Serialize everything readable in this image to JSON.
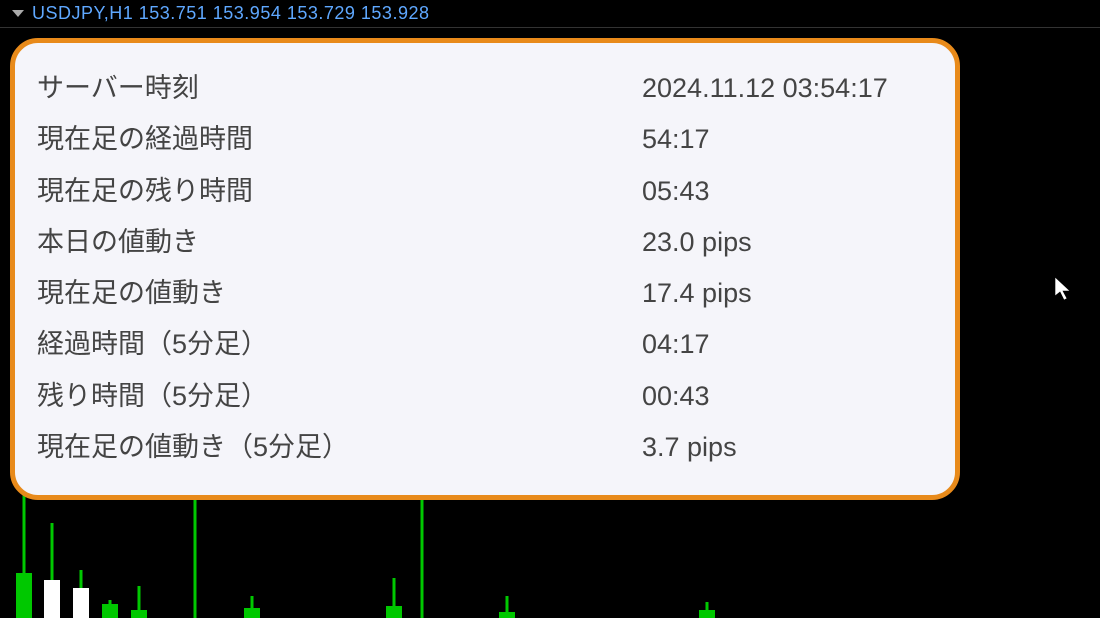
{
  "header": {
    "title": "USDJPY,H1  153.751 153.954 153.729 153.928"
  },
  "info": {
    "rows": [
      {
        "label": "サーバー時刻",
        "value": "2024.11.12 03:54:17"
      },
      {
        "label": "現在足の経過時間",
        "value": "54:17"
      },
      {
        "label": "現在足の残り時間",
        "value": "05:43"
      },
      {
        "label": "本日の値動き",
        "value": "23.0 pips"
      },
      {
        "label": "現在足の値動き",
        "value": "17.4 pips"
      },
      {
        "label": "経過時間（5分足）",
        "value": "04:17"
      },
      {
        "label": "残り時間（5分足）",
        "value": "00:43"
      },
      {
        "label": "現在足の値動き（5分足）",
        "value": "3.7 pips"
      }
    ]
  }
}
